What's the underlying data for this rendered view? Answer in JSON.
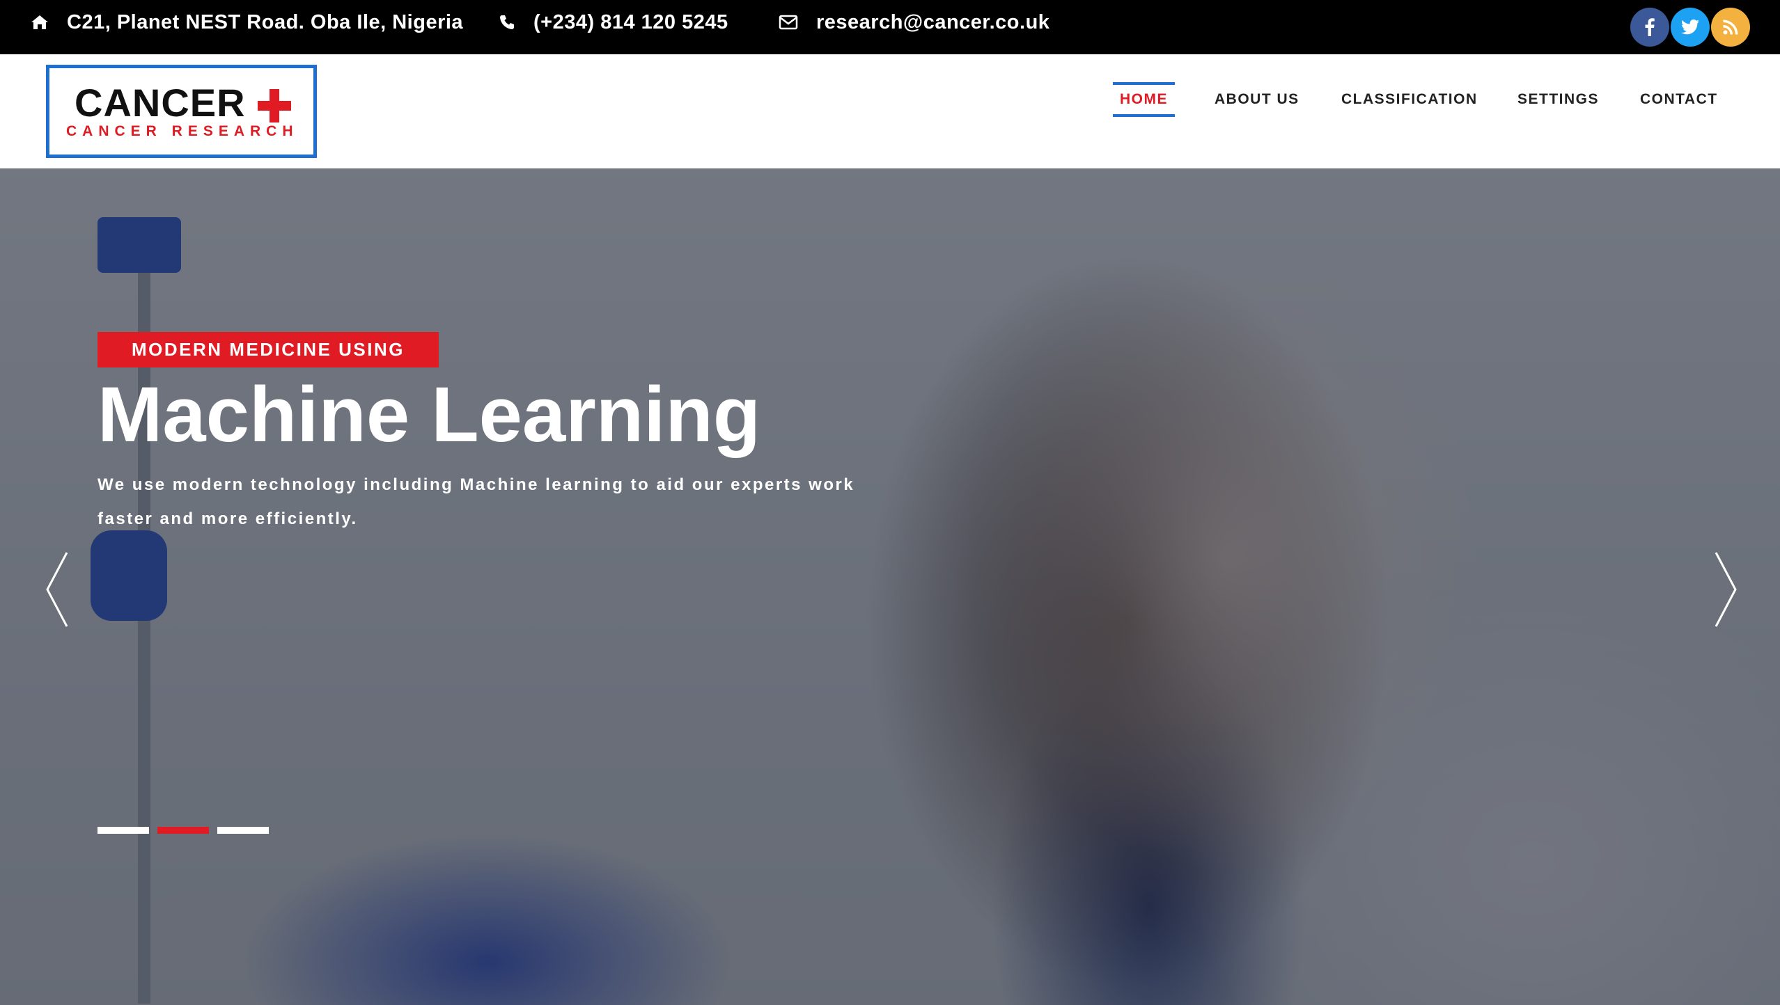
{
  "topbar": {
    "address": "C21, Planet NEST Road. Oba Ile, Nigeria",
    "phone": "(+234) 814 120 5245",
    "email": "research@cancer.co.uk",
    "social": [
      {
        "name": "facebook",
        "icon": "facebook-icon",
        "color": "#3b5998"
      },
      {
        "name": "twitter",
        "icon": "twitter-icon",
        "color": "#1da1f2"
      },
      {
        "name": "rss",
        "icon": "rss-icon",
        "color": "#f3b240"
      }
    ]
  },
  "logo": {
    "word": "CANCER",
    "subtitle": "CANCER RESEARCH"
  },
  "nav": {
    "items": [
      {
        "label": "HOME",
        "active": true
      },
      {
        "label": "ABOUT US",
        "active": false
      },
      {
        "label": "CLASSIFICATION",
        "active": false
      },
      {
        "label": "SETTINGS",
        "active": false
      },
      {
        "label": "CONTACT",
        "active": false
      }
    ]
  },
  "hero": {
    "tag": "MODERN MEDICINE USING",
    "headline": "Machine Learning",
    "description": "We use modern technology including Machine learning to aid our experts work faster and more efficiently.",
    "slides_count": 3,
    "active_slide": 2
  },
  "colors": {
    "accent_red": "#e01b24",
    "accent_blue": "#1f6fd1",
    "topbar_bg": "#000000"
  }
}
